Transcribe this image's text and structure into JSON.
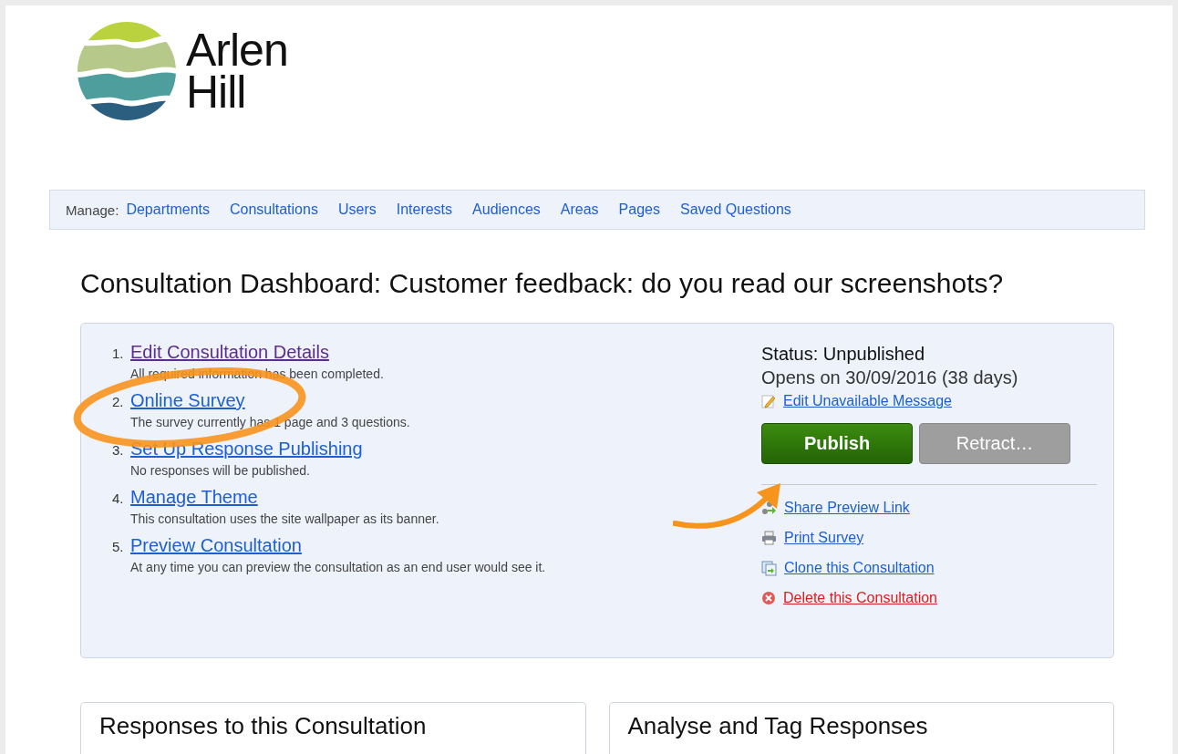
{
  "logo": {
    "line_1": "Arlen",
    "line_2": "Hill"
  },
  "manage_bar": {
    "label": "Manage:",
    "links": [
      "Departments",
      "Consultations",
      "Users",
      "Interests",
      "Audiences",
      "Areas",
      "Pages",
      "Saved Questions"
    ]
  },
  "title": "Consultation Dashboard: Customer feedback: do you read our screenshots?",
  "steps": [
    {
      "number": "1.",
      "link": "Edit Consultation Details",
      "visited": true,
      "note": "All required information has been completed."
    },
    {
      "number": "2.",
      "link": "Online Survey",
      "visited": false,
      "note": "The survey currently has 1 page and 3 questions."
    },
    {
      "number": "3.",
      "link": "Set Up Response Publishing",
      "visited": false,
      "note": "No responses will be published."
    },
    {
      "number": "4.",
      "link": "Manage Theme",
      "visited": false,
      "note": "This consultation uses the site wallpaper as its banner."
    },
    {
      "number": "5.",
      "link": "Preview Consultation",
      "visited": false,
      "note": "At any time you can preview the consultation as an end user would see it."
    }
  ],
  "status": {
    "state": "Status: Unpublished",
    "opens": "Opens on 30/09/2016 (38 days)",
    "message_link": "Edit Unavailable Message"
  },
  "buttons": [
    {
      "label": "Publish",
      "kind": "primary",
      "disabled": false
    },
    {
      "label": "Retract…",
      "kind": "secondary",
      "disabled": true
    }
  ],
  "actions": [
    {
      "label": "Share Preview Link",
      "danger": false
    },
    {
      "label": "Print Survey",
      "danger": false
    },
    {
      "label": "Clone this Consultation",
      "danger": false
    },
    {
      "label": "Delete this Consultation",
      "danger": true
    }
  ],
  "cards": [
    "Responses to this Consultation",
    "Analyse and Tag Responses"
  ]
}
